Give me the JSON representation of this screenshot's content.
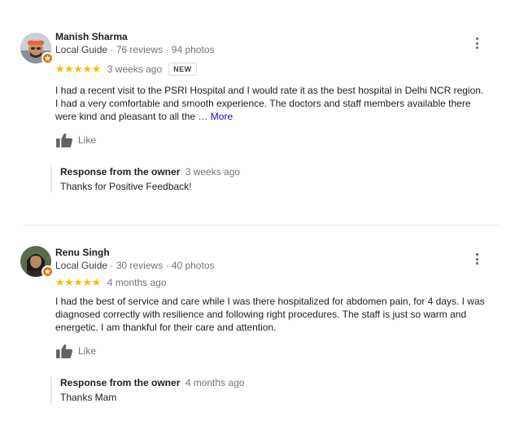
{
  "reviews": [
    {
      "name": "Manish Sharma",
      "guide": "Local Guide",
      "reviews_count": "76 reviews",
      "photos_count": "94 photos",
      "stars": "★★★★★",
      "rating": 5,
      "time_ago": "3 weeks ago",
      "new_badge": "NEW",
      "text": "I had a recent visit to the PSRI Hospital and I would rate it as the best hospital in Delhi NCR region. I had a very comfortable and smooth experience. The doctors and staff members available there were kind and pleasant to all the …",
      "more_label": "More",
      "like_label": "Like",
      "owner_response_title": "Response from the owner",
      "owner_response_ago": "3 weeks ago",
      "owner_response_text": "Thanks for Positive Feedback!"
    },
    {
      "name": "Renu Singh",
      "guide": "Local Guide",
      "reviews_count": "30 reviews",
      "photos_count": "40 photos",
      "stars": "★★★★★",
      "rating": 5,
      "time_ago": "4 months ago",
      "text": "I had the best of service and care while I was there hospitalized for abdomen pain, for 4 days. I was diagnosed correctly with resilience and following right procedures. The staff is just so warm and energetic. I am thankful for their care and attention.",
      "like_label": "Like",
      "owner_response_title": "Response from the owner",
      "owner_response_ago": "4 months ago",
      "owner_response_text": "Thanks Mam"
    }
  ],
  "meta_separator": "·",
  "colors": {
    "star": "#fbbc04",
    "guide_badge": "#e8710a",
    "link": "#1a0dab",
    "secondary_text": "#70757a"
  },
  "icons": [
    "more-vert-icon",
    "thumbs-up-icon",
    "local-guide-badge-icon"
  ]
}
